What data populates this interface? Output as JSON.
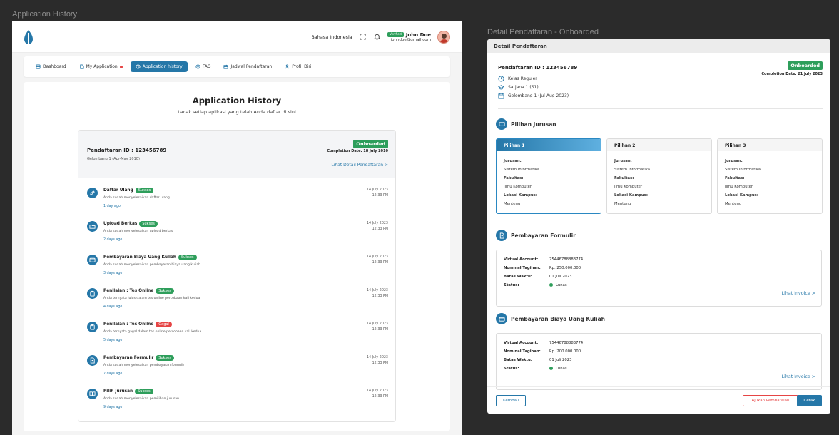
{
  "frames": {
    "left_label": "Application History",
    "right_label": "Detail Pendaftaran - Onboarded"
  },
  "topbar": {
    "language": "Bahasa Indonesia",
    "verified_badge": "Verified",
    "user_name": "John Doe",
    "user_email": "johndoe@gmail.com"
  },
  "nav": {
    "items": [
      {
        "label": "Dashboard",
        "icon": "dashboard-icon"
      },
      {
        "label": "My Application",
        "icon": "file-icon"
      },
      {
        "label": "Application history",
        "icon": "clock-icon"
      },
      {
        "label": "FAQ",
        "icon": "help-circle-icon"
      },
      {
        "label": "Jadwal Pendaftaran",
        "icon": "calendar-icon"
      },
      {
        "label": "Profil Diri",
        "icon": "user-icon"
      }
    ],
    "active_index": 2
  },
  "history": {
    "title": "Application History",
    "subtitle": "Lacak setiap aplikasi yang telah Anda daftar di sini",
    "registration_id": "Pendaftaran ID : 123456789",
    "wave": "Gelombang 1 (Apr-May 2010)",
    "status": "Onboarded",
    "completion_date": "Completion Date: 18 July 2010",
    "detail_link": "Lihat Detail Pendaftaran >",
    "items": [
      {
        "title": "Daftar Ulang",
        "status": "Sukses",
        "status_type": "ok",
        "desc": "Anda sudah menyelesaikan daftar ulang",
        "ago": "1 day ago",
        "date": "14 July 2023",
        "time": "12:33 PM",
        "icon": "edit-icon"
      },
      {
        "title": "Upload Berkas",
        "status": "Sukses",
        "status_type": "ok",
        "desc": "Anda sudah menyelesaikan upload berkas",
        "ago": "2 days ago",
        "date": "14 July 2023",
        "time": "12:33 PM",
        "icon": "folder-icon"
      },
      {
        "title": "Pembayaran Biaya Uang Kuliah",
        "status": "Sukses",
        "status_type": "ok",
        "desc": "Anda sudah menyelesaikan pembayaran biaya uang kuliah",
        "ago": "3 days ago",
        "date": "14 July 2023",
        "time": "12:33 PM",
        "icon": "card-icon"
      },
      {
        "title": "Penilaian : Tes Online",
        "status": "Sukses",
        "status_type": "ok",
        "desc": "Anda ternyata lulus dalam tes online percobaan kali kedua",
        "ago": "4 days ago",
        "date": "14 July 2023",
        "time": "12:33 PM",
        "icon": "clipboard-icon"
      },
      {
        "title": "Penilaian : Tes Online",
        "status": "Gagal",
        "status_type": "bad",
        "desc": "Anda ternyata gagal dalam tes online percobaan kali kedua",
        "ago": "5 days ago",
        "date": "14 July 2023",
        "time": "12:33 PM",
        "icon": "clipboard-icon"
      },
      {
        "title": "Pembayaran Formulir",
        "status": "Sukses",
        "status_type": "ok",
        "desc": "Anda sudah menyelesaikan pembayaran formulir",
        "ago": "7 days ago",
        "date": "14 July 2023",
        "time": "12:33 PM",
        "icon": "document-icon"
      },
      {
        "title": "Pilih Jurusan",
        "status": "Sukses",
        "status_type": "ok",
        "desc": "Anda sudah menyelesaikan pemilihan jurusan",
        "ago": "9 days ago",
        "date": "14 July 2023",
        "time": "12:33 PM",
        "icon": "book-icon"
      }
    ]
  },
  "detail": {
    "header": "Detail Pendaftaran",
    "registration_id": "Pendaftaran ID : 123456789",
    "status": "Onboarded",
    "completion_date": "Completion Date: 21 July 2023",
    "class": "Kelas Reguler",
    "degree": "Sarjana 1 (S1)",
    "wave": "Gelombang 1 (Jul-Aug 2023)",
    "majors_title": "Pilihan Jurusan",
    "labels": {
      "major": "Jurusan:",
      "faculty": "Fakultas:",
      "campus": "Lokasi Kampus:"
    },
    "choices": [
      {
        "title": "Pilihan 1",
        "major": "Sistem Informatika",
        "faculty": "Ilmu Komputer",
        "campus": "Menteng"
      },
      {
        "title": "Pilihan 2",
        "major": "Sistem Informatika",
        "faculty": "Ilmu Komputer",
        "campus": "Menteng"
      },
      {
        "title": "Pilihan 3",
        "major": "Sistem Informatika",
        "faculty": "Ilmu Komputer",
        "campus": "Menteng"
      }
    ],
    "pay_labels": {
      "va": "Virtual Account:",
      "amount": "Nominal Tagihan:",
      "deadline": "Batas Waktu:",
      "status": "Status:"
    },
    "form_payment": {
      "title": "Pembayaran Formulir",
      "va": "75446788883774",
      "amount": "Rp. 250.000.000",
      "deadline": "01 Juli 2023",
      "status": "Lunas",
      "link": "Lihat Invoice >"
    },
    "tuition_payment": {
      "title": "Pembayaran Biaya Uang Kuliah",
      "va": "75446788883774",
      "amount": "Rp. 200.000.000",
      "deadline": "01 Juli 2023",
      "status": "Lunas",
      "link": "Lihat Invoice >"
    },
    "buttons": {
      "back": "Kembali",
      "cancel": "Ajukan Pembatalan",
      "print": "Cetak"
    }
  },
  "colors": {
    "primary": "#2577a8",
    "success": "#2e9e5b",
    "danger": "#e64545"
  }
}
